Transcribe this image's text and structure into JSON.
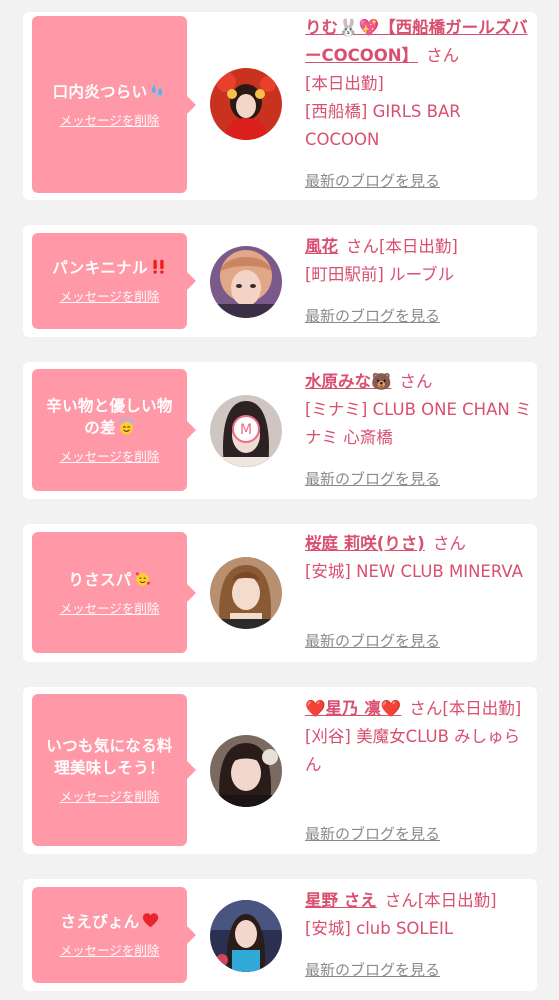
{
  "delete_label": "メッセージを削除",
  "blog_label": "最新のブログを見る",
  "san_label": "さん",
  "colors": {
    "bubble": "#ff99a8",
    "accent": "#d94f70",
    "link_gray": "#8a8a8a",
    "background": "#f2f2f2"
  },
  "cards": [
    {
      "message": "口内炎つらい",
      "message_emoji": "sweat-droplets-icon",
      "name": "りむ🐰💖【西船橋ガールズバーCOCOON】",
      "status": "[本日出勤]",
      "shop": "[西船橋] GIRLS BAR COCOON"
    },
    {
      "message": "パンキニナル",
      "message_emoji": "double-exclamation-icon",
      "name": "風花",
      "status": "[本日出勤]",
      "shop": "[町田駅前] ルーブル"
    },
    {
      "message": "辛い物と優しい物の差",
      "message_emoji": "smiling-halo-icon",
      "name": "水原みな🐻",
      "status": "",
      "shop": "[ミナミ] CLUB ONE CHAN ミナミ 心斎橋"
    },
    {
      "message": "りさスパ",
      "message_emoji": "smiling-hearts-icon",
      "name": "桜庭 莉咲(りさ)",
      "status": "",
      "shop": "[安城] NEW CLUB MINERVA"
    },
    {
      "message": "いつも気になる料理美味しそう！",
      "message_emoji": "",
      "name": "❤️星乃 凛❤️",
      "status": "[本日出勤]",
      "shop": "[刈谷] 美魔女CLUB みしゅらん"
    },
    {
      "message": "さえぴょん",
      "message_emoji": "red-heart-icon",
      "name": "星野 さえ",
      "status": "[本日出勤]",
      "shop": "[安城] club SOLEIL"
    }
  ]
}
